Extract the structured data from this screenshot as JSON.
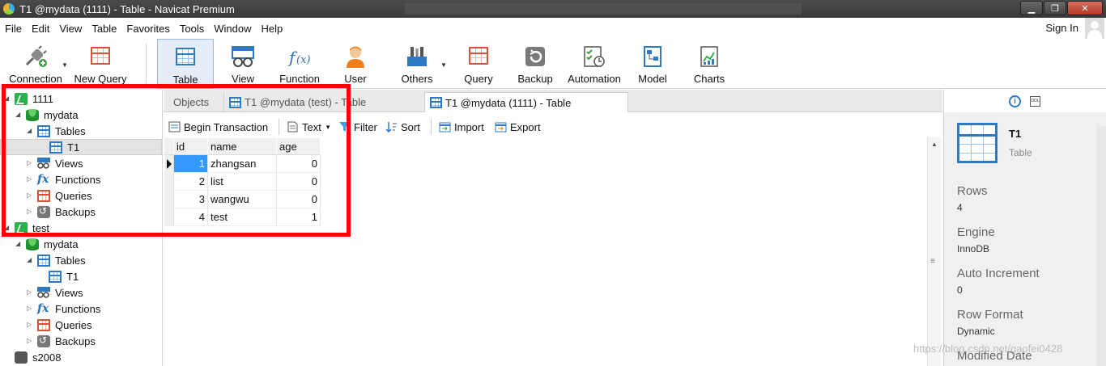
{
  "window": {
    "title": "T1 @mydata (1111) - Table - Navicat Premium",
    "min_glyph": "▁",
    "max_glyph": "❐",
    "close_glyph": "✕"
  },
  "menu": [
    "File",
    "Edit",
    "View",
    "Table",
    "Favorites",
    "Tools",
    "Window",
    "Help"
  ],
  "signin_label": "Sign In",
  "toolbar": {
    "connection": "Connection",
    "new_query": "New Query",
    "table": "Table",
    "view": "View",
    "function": "Function",
    "user": "User",
    "others": "Others",
    "query": "Query",
    "backup": "Backup",
    "automation": "Automation",
    "model": "Model",
    "charts": "Charts",
    "dropdown_glyph": "▼"
  },
  "tree": {
    "conn1": "1111",
    "db1": "mydata",
    "tables1": "Tables",
    "t1": "T1",
    "views1": "Views",
    "functions1": "Functions",
    "queries1": "Queries",
    "backups1": "Backups",
    "conn2": "test",
    "db2": "mydata",
    "tables2": "Tables",
    "t2": "T1",
    "views2": "Views",
    "functions2": "Functions",
    "queries2": "Queries",
    "backups2": "Backups",
    "conn3": "s2008",
    "expanded_glyph": "◢",
    "collapsed_glyph": "▷",
    "fx_glyph": "fx"
  },
  "tabs": {
    "objects": "Objects",
    "t1_test": "T1 @mydata (test) - Table",
    "t1_active": "T1 @mydata (1111) - Table"
  },
  "table_toolbar": {
    "begin_transaction": "Begin Transaction",
    "text": "Text",
    "filter": "Filter",
    "sort": "Sort",
    "import": "Import",
    "export": "Export",
    "dropdown_glyph": "▾"
  },
  "grid": {
    "columns": [
      "id",
      "name",
      "age"
    ],
    "rows": [
      {
        "id": "1",
        "name": "zhangsan",
        "age": "0"
      },
      {
        "id": "2",
        "name": "list",
        "age": "0"
      },
      {
        "id": "3",
        "name": "wangwu",
        "age": "0"
      },
      {
        "id": "4",
        "name": "test",
        "age": "1"
      }
    ],
    "scroll_up_glyph": "▲",
    "scroll_grip_glyph": "≡"
  },
  "right_panel": {
    "object_name": "T1",
    "object_type": "Table",
    "info_glyph": "i",
    "ddl_glyph": "DDL",
    "props": [
      {
        "label": "Rows",
        "value": "4"
      },
      {
        "label": "Engine",
        "value": "InnoDB"
      },
      {
        "label": "Auto Increment",
        "value": "0"
      },
      {
        "label": "Row Format",
        "value": "Dynamic"
      },
      {
        "label": "Modified Date",
        "value": ""
      }
    ]
  },
  "watermark": "https://blog.csdn.net/gaofei0428",
  "colors": {
    "accent": "#2f78c4",
    "highlight_box": "#ff0000",
    "selected_cell": "#3399ff"
  }
}
